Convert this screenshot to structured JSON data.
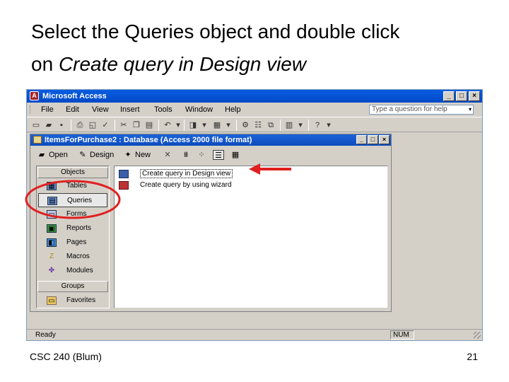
{
  "slide": {
    "title_line1": "Select the Queries object and double click",
    "title_line2_prefix": "on ",
    "title_line2_italic": "Create query in Design view",
    "footer_left": "CSC 240 (Blum)",
    "footer_right": "21"
  },
  "app": {
    "title": "Microsoft Access",
    "icon_letter": "A",
    "window_buttons": [
      "_",
      "□",
      "×"
    ],
    "menu": [
      "File",
      "Edit",
      "View",
      "Insert",
      "Tools",
      "Window",
      "Help"
    ],
    "help_placeholder": "Type a question for help",
    "status_text": "Ready",
    "status_num": "NUM"
  },
  "db_window": {
    "title": "ItemsForPurchase2 : Database (Access 2000 file format)",
    "window_buttons": [
      "_",
      "□",
      "×"
    ],
    "toolbar": {
      "open_label": "Open",
      "design_label": "Design",
      "new_label": "New"
    },
    "objects_header": "Objects",
    "objects": [
      {
        "label": "Tables",
        "icon": "table-icon"
      },
      {
        "label": "Queries",
        "icon": "query-icon",
        "selected": true
      },
      {
        "label": "Forms",
        "icon": "form-icon"
      },
      {
        "label": "Reports",
        "icon": "report-icon"
      },
      {
        "label": "Pages",
        "icon": "page-icon"
      },
      {
        "label": "Macros",
        "icon": "macro-icon"
      },
      {
        "label": "Modules",
        "icon": "module-icon"
      }
    ],
    "groups_header": "Groups",
    "groups": [
      {
        "label": "Favorites",
        "icon": "folder-icon"
      }
    ],
    "list_items": [
      {
        "label": "Create query in Design view",
        "selected": true
      },
      {
        "label": "Create query by using wizard"
      }
    ]
  },
  "colors": {
    "annotation_red": "#e02020",
    "titlebar_blue": "#0a5de0"
  }
}
